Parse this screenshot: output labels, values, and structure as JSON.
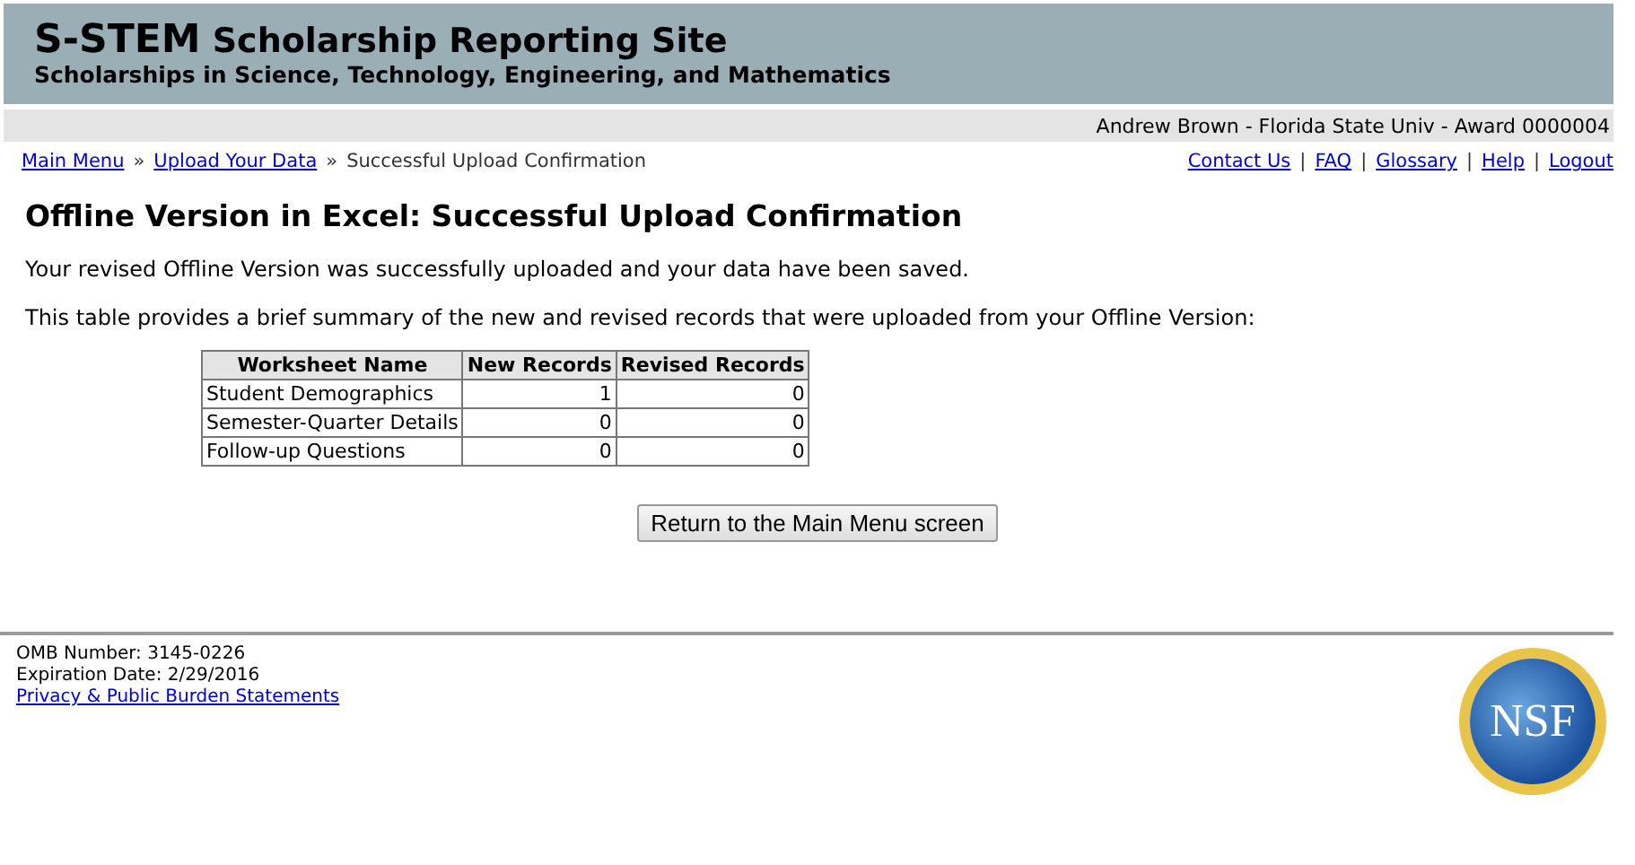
{
  "header": {
    "title_main": "S-STEM",
    "title_rest": "Scholarship Reporting Site",
    "subtitle": "Scholarships in Science, Technology, Engineering, and Mathematics"
  },
  "user_bar": "Andrew Brown - Florida State Univ - Award 0000004",
  "breadcrumbs": [
    {
      "label": "Main Menu",
      "link": true
    },
    {
      "label": "Upload Your Data",
      "link": true
    },
    {
      "label": "Successful Upload Confirmation",
      "link": false
    }
  ],
  "breadcrumb_separator": "»",
  "top_links": [
    "Contact Us",
    "FAQ",
    "Glossary",
    "Help",
    "Logout"
  ],
  "link_separator": "|",
  "page_title": "Offline Version in Excel: Successful Upload Confirmation",
  "paragraphs": [
    "Your revised Offline Version was successfully uploaded and your data have been saved.",
    "This table provides a brief summary of the new and revised records that were uploaded from your Offline Version:"
  ],
  "table": {
    "columns": [
      "Worksheet Name",
      "New Records",
      "Revised Records"
    ],
    "rows": [
      [
        "Student Demographics",
        "1",
        "0"
      ],
      [
        "Semester-Quarter Details",
        "0",
        "0"
      ],
      [
        "Follow-up Questions",
        "0",
        "0"
      ]
    ]
  },
  "button": "Return to the Main Menu screen",
  "footer": {
    "lines": [
      "OMB Number: 3145-0226",
      "Expiration Date: 2/29/2016"
    ],
    "link": "Privacy & Public Burden Statements",
    "logo_text": "NSF"
  }
}
